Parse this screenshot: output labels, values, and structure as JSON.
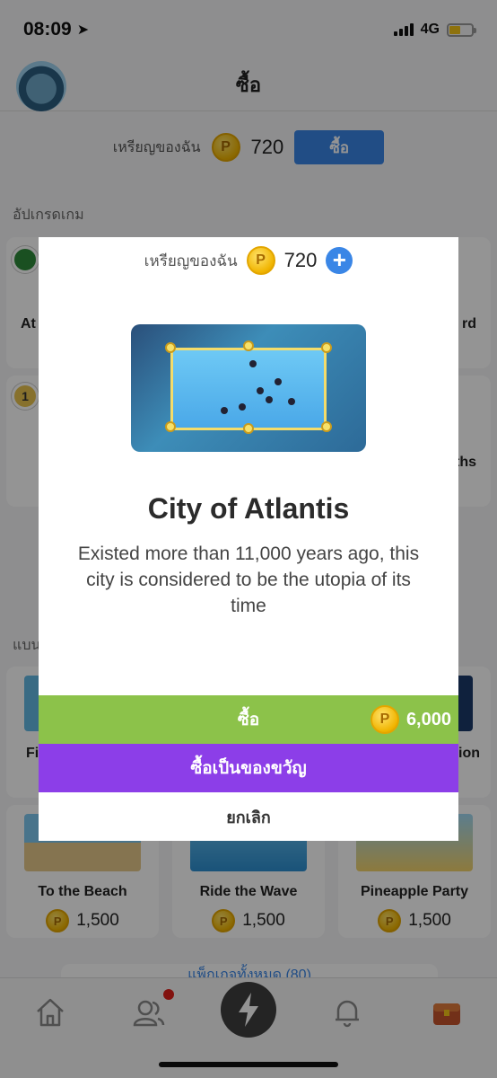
{
  "status_bar": {
    "time": "08:09",
    "network": "4G"
  },
  "header": {
    "title": "ซื้อ"
  },
  "coin_bar": {
    "label": "เหรียญของฉัน",
    "coin_symbol": "P",
    "amount": "720",
    "buy_label": "ซื้อ"
  },
  "upgrade_section": {
    "label": "อัปเกรดเกม",
    "cards": [
      {
        "title": "At"
      },
      {
        "title": "rd"
      },
      {
        "title": "ths"
      }
    ]
  },
  "theme_section": {
    "label": "แบน",
    "cards_row1": [
      {
        "title": "Fi"
      },
      {
        "title": "ion"
      }
    ],
    "cards_row2": [
      {
        "title": "To the Beach",
        "price": "1,500"
      },
      {
        "title": "Ride the Wave",
        "price": "1,500"
      },
      {
        "title": "Pineapple Party",
        "price": "1,500"
      }
    ]
  },
  "bottom_link": {
    "text": "แพ็กเกจทั้งหมด (80)"
  },
  "tabs": [
    "home-icon",
    "friends-icon",
    "bolt-icon",
    "bell-icon",
    "treasure-chest-icon"
  ],
  "modal": {
    "coins_label": "เหรียญของฉัน",
    "coin_symbol": "P",
    "coins_amount": "720",
    "plus_label": "+",
    "title": "City of Atlantis",
    "description": "Existed more than 11,000 years ago, this city is considered to be the utopia of its time",
    "buy_label": "ซื้อ",
    "price": "6,000",
    "gift_label": "ซื้อเป็นของขวัญ",
    "cancel_label": "ยกเลิก"
  },
  "colors": {
    "accent_blue": "#3a86e6",
    "buy_green": "#8cc24a",
    "gift_purple": "#8c3ee8",
    "coin_gold": "#f0b400"
  }
}
